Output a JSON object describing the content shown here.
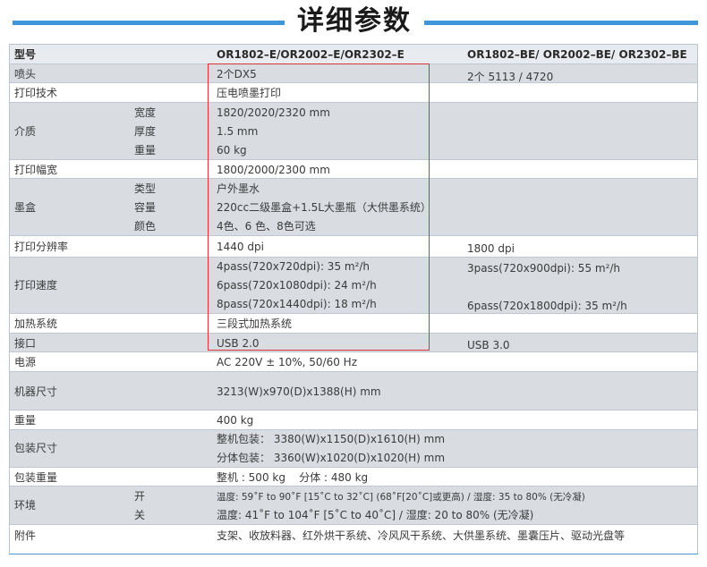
{
  "title": "详细参数",
  "header": {
    "label": "型号",
    "col1": "OR1802–E/OR2002–E/OR2302–E",
    "col2": "OR1802–BE/ OR2002–BE/ OR2302–BE"
  },
  "nozzle": {
    "label": "喷头",
    "v1": "2个DX5",
    "v2": "2个 5113 / 4720"
  },
  "print_tech": {
    "label": "打印技术",
    "v1": "压电喷墨打印"
  },
  "media": {
    "label": "介质",
    "width_label": "宽度",
    "width": "1820/2020/2320 mm",
    "thickness_label": "厚度",
    "thickness": "1.5 mm",
    "weight_label": "重量",
    "weight": "60 kg"
  },
  "print_width": {
    "label": "打印幅宽",
    "v1": "1800/2000/2300 mm"
  },
  "ink": {
    "label": "墨盒",
    "type_label": "类型",
    "type": "户外墨水",
    "capacity_label": "容量",
    "capacity": "220cc二级墨盒+1.5L大墨瓶（大供墨系统）",
    "color_label": "颜色",
    "color": "4色、6 色、8色可选"
  },
  "resolution": {
    "label": "打印分辨率",
    "v1": "1440 dpi",
    "v2": "1800 dpi"
  },
  "speed": {
    "label": "打印速度",
    "v1_a": "4pass(720x720dpi):  35 m²/h",
    "v1_b": "6pass(720x1080dpi): 24 m²/h",
    "v1_c": "8pass(720x1440dpi): 18 m²/h",
    "v2_a": "3pass(720x900dpi):   55 m²/h",
    "v2_b": "6pass(720x1800dpi): 35 m²/h"
  },
  "heating": {
    "label": "加热系统",
    "v1": "三段式加热系统"
  },
  "interface": {
    "label": "接口",
    "v1": "USB 2.0",
    "v2": "USB 3.0"
  },
  "power": {
    "label": "电源",
    "v1": "AC 220V ± 10%, 50/60 Hz"
  },
  "dimensions": {
    "label": "机器尺寸",
    "v1": "3213(W)x970(D)x1388(H) mm"
  },
  "weight": {
    "label": "重量",
    "v1": "400 kg"
  },
  "package_size": {
    "label": "包装尺寸",
    "v1_a": "整机包装： 3380(W)x1150(D)x1610(H) mm",
    "v1_b": "分体包装： 3360(W)x1020(D)x1020(H) mm"
  },
  "package_weight": {
    "label": "包装重量",
    "v1": "整机 : 500 kg    分体 : 480 kg"
  },
  "environment": {
    "label": "环境",
    "on_label": "开",
    "on": "温度: 59˚F to 90˚F [15˚C to 32˚C] (68˚F[20˚C]或更高) / 湿度: 35 to 80% (无冷凝)",
    "off_label": "关",
    "off": "温度: 41˚F to 104˚F [5˚C to 40˚C] / 湿度: 20 to 80% (无冷凝)"
  },
  "accessories": {
    "label": "附件",
    "v1": "支架、收放料器、红外烘干系统、冷风风干系统、大供墨系统、墨囊压片、驱动光盘等"
  },
  "colors": {
    "accent": "#3f96d9",
    "highlight_box": "#d9343a",
    "row_gray": "#d9dde2"
  }
}
